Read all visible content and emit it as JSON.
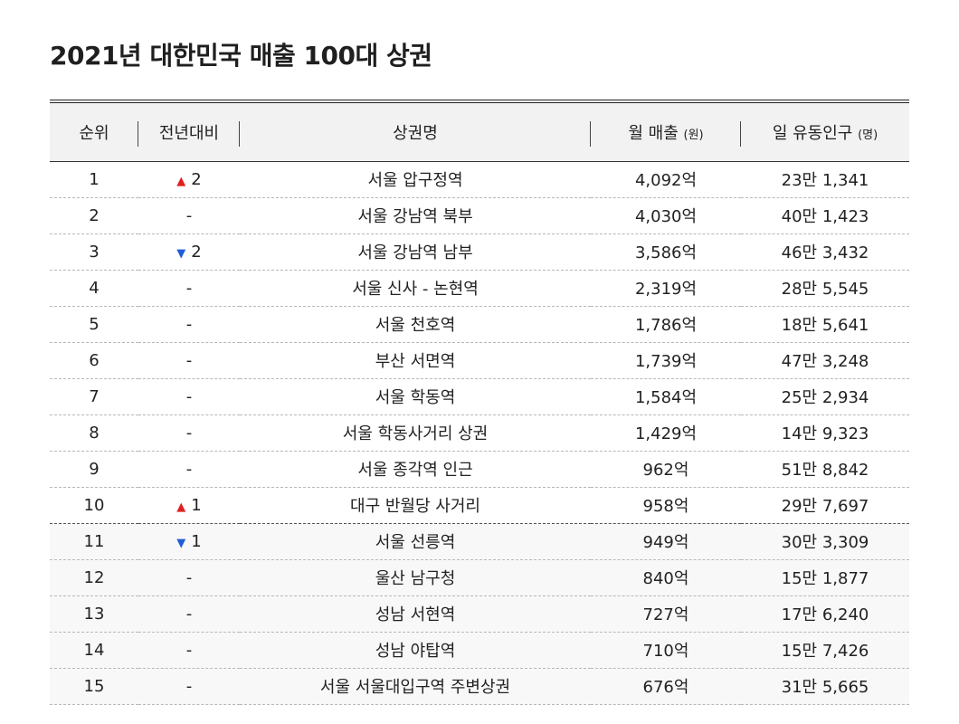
{
  "page": {
    "title": "2021년 대한민국 매출 100대 상권"
  },
  "table": {
    "headers": {
      "rank": "순위",
      "change": "전년대비",
      "name": "상권명",
      "sales": "월 매출",
      "sales_unit": "(원)",
      "population": "일 유동인구",
      "population_unit": "(명)"
    },
    "rows": [
      {
        "rank": "1",
        "dir": "up",
        "change": "2",
        "name": "서울 압구정역",
        "sales": "4,092억",
        "population": "23만 1,341"
      },
      {
        "rank": "2",
        "dir": "none",
        "change": "-",
        "name": "서울 강남역 북부",
        "sales": "4,030억",
        "population": "40만 1,423"
      },
      {
        "rank": "3",
        "dir": "down",
        "change": "2",
        "name": "서울 강남역 남부",
        "sales": "3,586억",
        "population": "46만 3,432"
      },
      {
        "rank": "4",
        "dir": "none",
        "change": "-",
        "name": "서울 신사 - 논현역",
        "sales": "2,319억",
        "population": "28만 5,545"
      },
      {
        "rank": "5",
        "dir": "none",
        "change": "-",
        "name": "서울 천호역",
        "sales": "1,786억",
        "population": "18만 5,641"
      },
      {
        "rank": "6",
        "dir": "none",
        "change": "-",
        "name": "부산 서면역",
        "sales": "1,739억",
        "population": "47만 3,248"
      },
      {
        "rank": "7",
        "dir": "none",
        "change": "-",
        "name": "서울 학동역",
        "sales": "1,584억",
        "population": "25만 2,934"
      },
      {
        "rank": "8",
        "dir": "none",
        "change": "-",
        "name": "서울 학동사거리 상권",
        "sales": "1,429억",
        "population": "14만 9,323"
      },
      {
        "rank": "9",
        "dir": "none",
        "change": "-",
        "name": "서울 종각역 인근",
        "sales": "962억",
        "population": "51만 8,842"
      },
      {
        "rank": "10",
        "dir": "up",
        "change": "1",
        "name": "대구 반월당 사거리",
        "sales": "958억",
        "population": "29만 7,697"
      },
      {
        "rank": "11",
        "dir": "down",
        "change": "1",
        "name": "서울 선릉역",
        "sales": "949억",
        "population": "30만 3,309"
      },
      {
        "rank": "12",
        "dir": "none",
        "change": "-",
        "name": "울산 남구청",
        "sales": "840억",
        "population": "15만 1,877"
      },
      {
        "rank": "13",
        "dir": "none",
        "change": "-",
        "name": "성남 서현역",
        "sales": "727억",
        "population": "17만 6,240"
      },
      {
        "rank": "14",
        "dir": "none",
        "change": "-",
        "name": "성남 야탑역",
        "sales": "710억",
        "population": "15만 7,426"
      },
      {
        "rank": "15",
        "dir": "none",
        "change": "-",
        "name": "서울 서울대입구역 주변상권",
        "sales": "676억",
        "population": "31만 5,665"
      }
    ]
  },
  "colors": {
    "up": "#e02020",
    "down": "#1f5fd6",
    "header_bg": "#f2f2f2",
    "alt_row_bg": "#f8f8f8"
  },
  "icons": {
    "up": "triangle-up-icon",
    "down": "triangle-down-icon"
  }
}
